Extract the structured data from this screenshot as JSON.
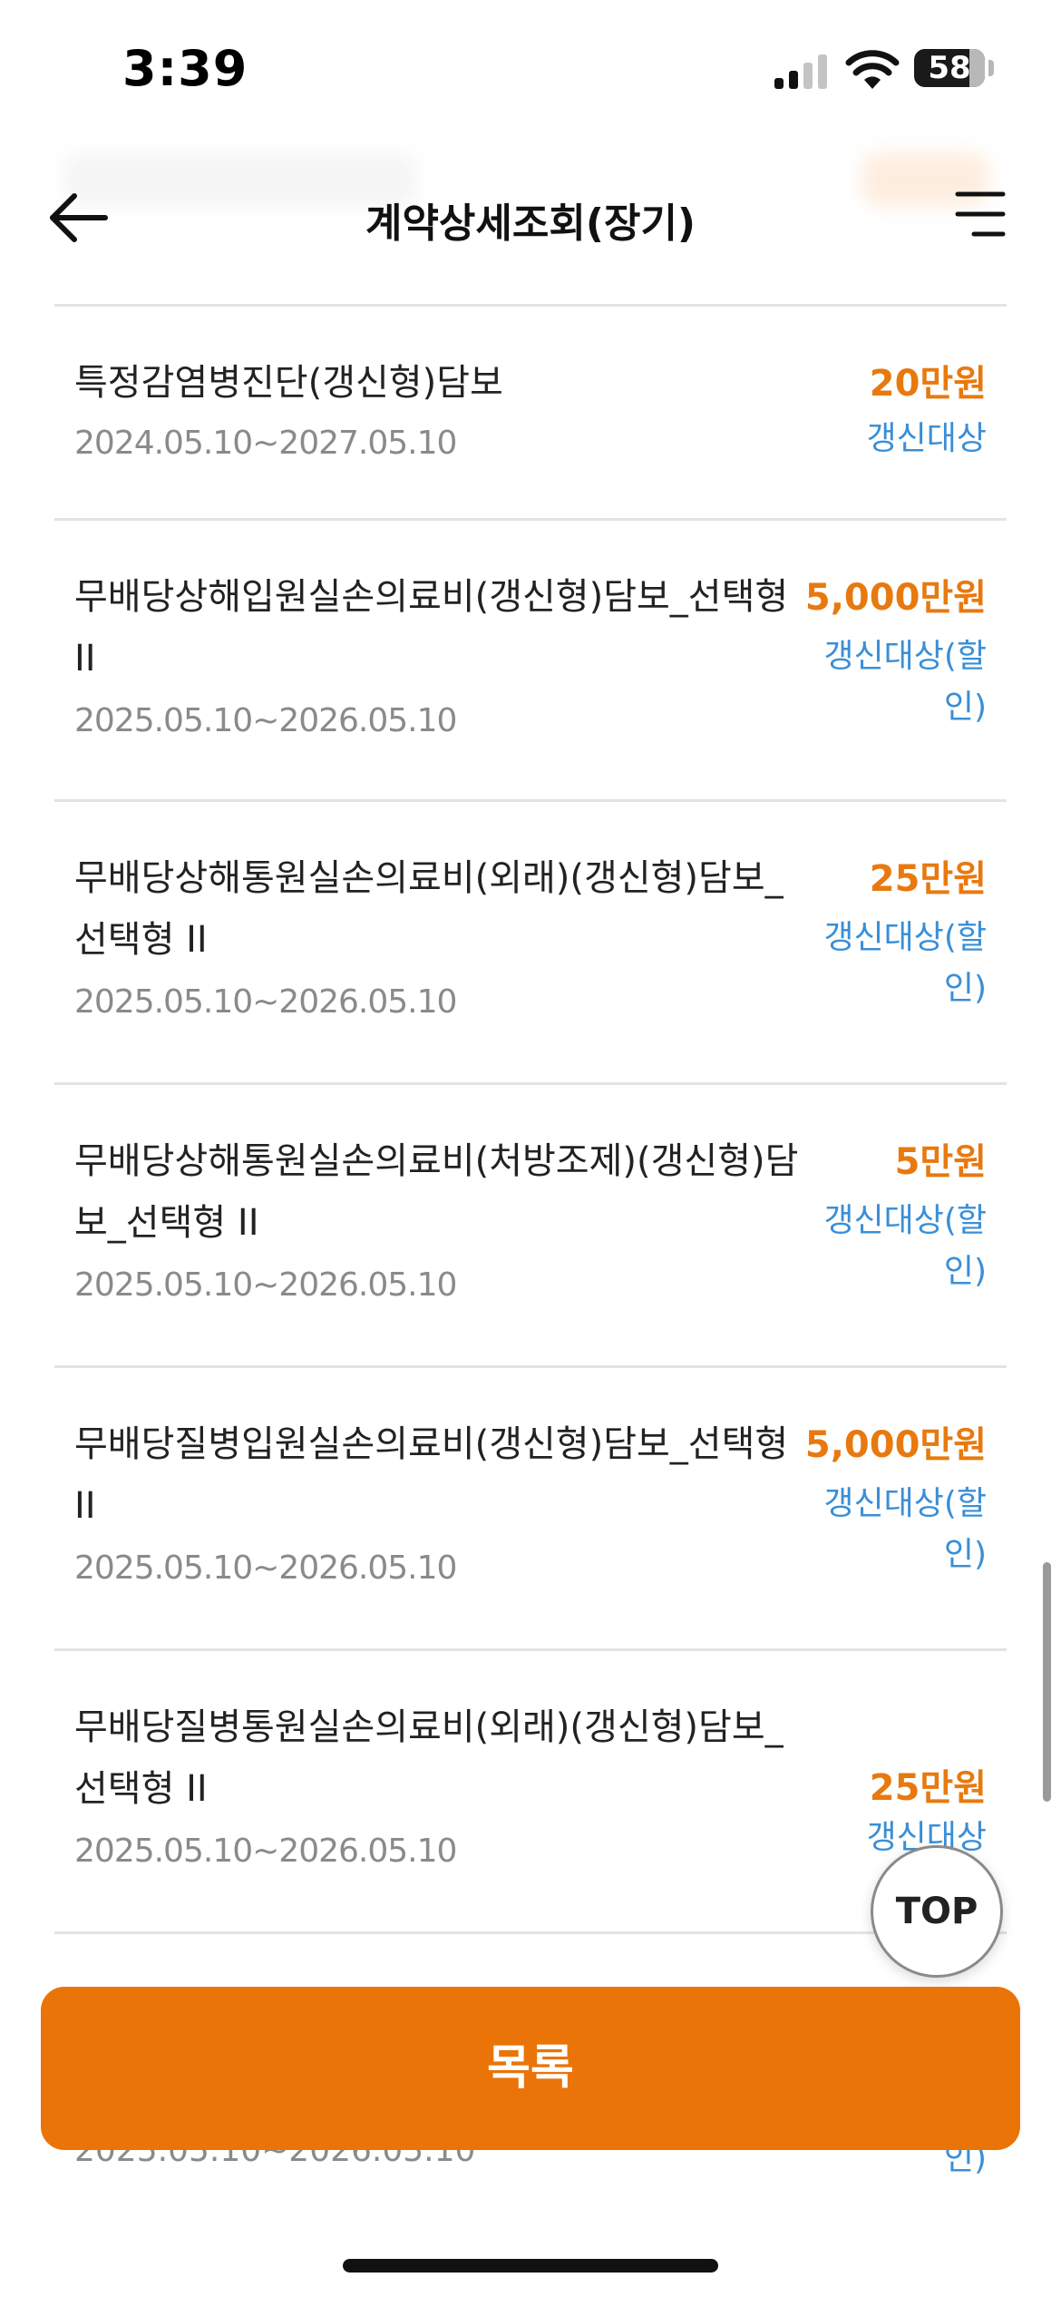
{
  "status_bar": {
    "time": "3:39",
    "battery": "58"
  },
  "header": {
    "title": "계약상세조회(장기)"
  },
  "items": [
    {
      "title": "특정감염병진단(갱신형)담보",
      "period": "2024.05.10~2027.05.10",
      "amount": "20만원",
      "status": "갱신대상"
    },
    {
      "title": "무배당상해입원실손의료비(갱신형)담보_선택형 II",
      "period": "2025.05.10~2026.05.10",
      "amount": "5,000만원",
      "status": "갱신대상(할인)"
    },
    {
      "title": "무배당상해통원실손의료비(외래)(갱신형)담보_선택형 II",
      "period": "2025.05.10~2026.05.10",
      "amount": "25만원",
      "status": "갱신대상(할인)"
    },
    {
      "title": "무배당상해통원실손의료비(처방조제)(갱신형)담보_선택형 II",
      "period": "2025.05.10~2026.05.10",
      "amount": "5만원",
      "status": "갱신대상(할인)"
    },
    {
      "title": "무배당질병입원실손의료비(갱신형)담보_선택형 II",
      "period": "2025.05.10~2026.05.10",
      "amount": "5,000만원",
      "status": "갱신대상(할인)"
    },
    {
      "title": "무배당질병통원실손의료비(외래)(갱신형)담보_선택형 II",
      "period": "2025.05.10~2026.05.10",
      "amount": "25만원",
      "status": "갱신대상"
    }
  ],
  "peek_row": {
    "period": "2025.05.10~2026.05.10",
    "status": "인)"
  },
  "top_button_label": "TOP",
  "list_button_label": "목록",
  "colors": {
    "accent_orange": "#ea7408",
    "amount_orange": "#e8790f",
    "status_blue": "#3a8fd6",
    "period_gray": "#8a8a8a"
  },
  "icons": {
    "back": "arrow-left-icon",
    "menu": "hamburger-menu-icon",
    "signal": "cellular-signal-icon",
    "wifi": "wifi-icon",
    "battery": "battery-icon"
  }
}
